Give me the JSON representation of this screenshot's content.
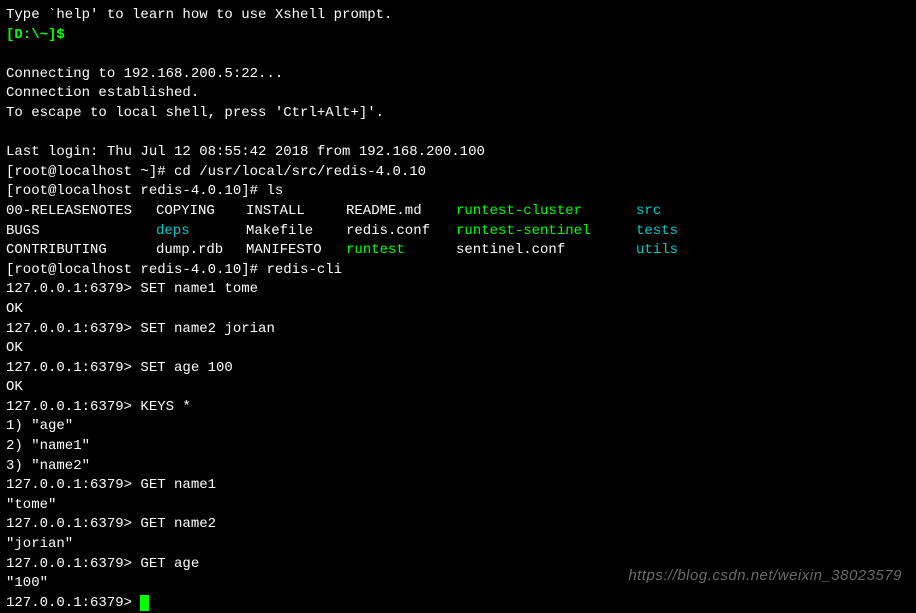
{
  "intro": {
    "help_line": "Type `help' to learn how to use Xshell prompt.",
    "local_prompt": "[D:\\~]$",
    "connecting": "Connecting to 192.168.200.5:22...",
    "established": "Connection established.",
    "escape": "To escape to local shell, press 'Ctrl+Alt+]'.",
    "last_login": "Last login: Thu Jul 12 08:55:42 2018 from 192.168.200.100"
  },
  "prompts": {
    "root_home": "[root@localhost ~]# ",
    "root_redis_dir": "[root@localhost redis-4.0.10]# ",
    "redis_cli": "127.0.0.1:6379> "
  },
  "commands": {
    "cd": "cd /usr/local/src/redis-4.0.10",
    "ls": "ls",
    "redis_cli": "redis-cli",
    "set1": "SET name1 tome",
    "set2": "SET name2 jorian",
    "set3": "SET age 100",
    "keys": "KEYS *",
    "get1": "GET name1",
    "get2": "GET name2",
    "get3": "GET age"
  },
  "responses": {
    "ok": "OK",
    "keys_result": [
      "1) \"age\"",
      "2) \"name1\"",
      "3) \"name2\""
    ],
    "get1_result": "\"tome\"",
    "get2_result": "\"jorian\"",
    "get3_result": "\"100\""
  },
  "ls_output": {
    "row1": {
      "c1": "00-RELEASENOTES",
      "c2": "COPYING",
      "c3": "INSTALL",
      "c4": "README.md",
      "c5": "runtest-cluster",
      "c6": "src"
    },
    "row2": {
      "c1": "BUGS",
      "c2": "deps",
      "c3": "Makefile",
      "c4": "redis.conf",
      "c5": "runtest-sentinel",
      "c6": "tests"
    },
    "row3": {
      "c1": "CONTRIBUTING",
      "c2": "dump.rdb",
      "c3": "MANIFESTO",
      "c4": "runtest",
      "c5": "sentinel.conf",
      "c6": "utils"
    }
  },
  "watermark": "https://blog.csdn.net/weixin_38023579"
}
